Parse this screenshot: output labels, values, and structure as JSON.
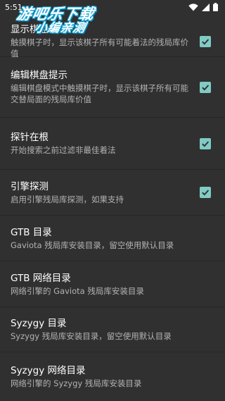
{
  "status_bar": {
    "time": "5:51"
  },
  "watermark": {
    "line1": "游吧乐下载",
    "line2": "小编亲测"
  },
  "settings": [
    {
      "title": "显示棋盘",
      "summary": "触摸棋子时，显示该棋子所有可能着法的残局库价值",
      "checked": true
    },
    {
      "title": "编辑棋盘提示",
      "summary": "编辑棋盘模式中触摸棋子时，显示该棋子所有可能交替局面的残局库价值",
      "checked": true
    },
    {
      "title": "探针在根",
      "summary": "开始搜索之前过滤非最佳着法",
      "checked": true
    },
    {
      "title": "引擎探测",
      "summary": "启用引擎残局库探测，如果支持",
      "checked": true
    },
    {
      "title": "GTB 目录",
      "summary": "Gaviota 残局库安装目录，留空使用默认目录"
    },
    {
      "title": "GTB 网络目录",
      "summary": "网络引擎的 Gaviota 残局库安装目录"
    },
    {
      "title": "Syzygy 目录",
      "summary": "Syzygy 残局库安装目录，留空使用默认目录"
    },
    {
      "title": "Syzygy 网络目录",
      "summary": "网络引擎的 Syzygy 残局库安装目录"
    }
  ]
}
